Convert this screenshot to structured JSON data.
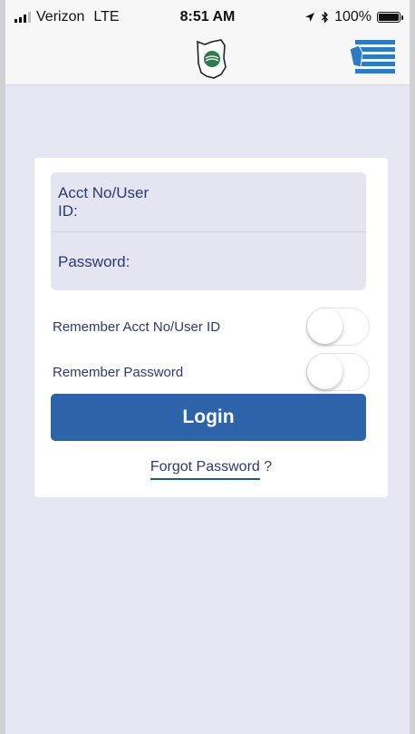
{
  "status_bar": {
    "carrier": "Verizon",
    "network": "LTE",
    "time": "8:51 AM",
    "battery": "100%",
    "icons": [
      "signal-icon",
      "location-arrow-icon",
      "bluetooth-icon",
      "battery-icon"
    ]
  },
  "nav": {
    "logo_icon": "ohio-state-logo-icon",
    "menu_icon": "hamburger-menu-icon"
  },
  "login_form": {
    "account_label": "Acct No/User ID:",
    "account_value": "",
    "password_label": "Password:",
    "password_value": "",
    "remember_account_label": "Remember Acct No/User ID",
    "remember_account_on": false,
    "remember_password_label": "Remember Password",
    "remember_password_on": false,
    "login_label": "Login",
    "forgot_password_link": "Forgot Password",
    "forgot_password_suffix": " ?"
  },
  "colors": {
    "background": "#e6e7f3",
    "field_background": "#e4e5f1",
    "primary_button": "#2d63a8",
    "text": "#2c3a6b",
    "logo_green": "#2f7b4b",
    "menu_blue": "#2d7bc4"
  }
}
